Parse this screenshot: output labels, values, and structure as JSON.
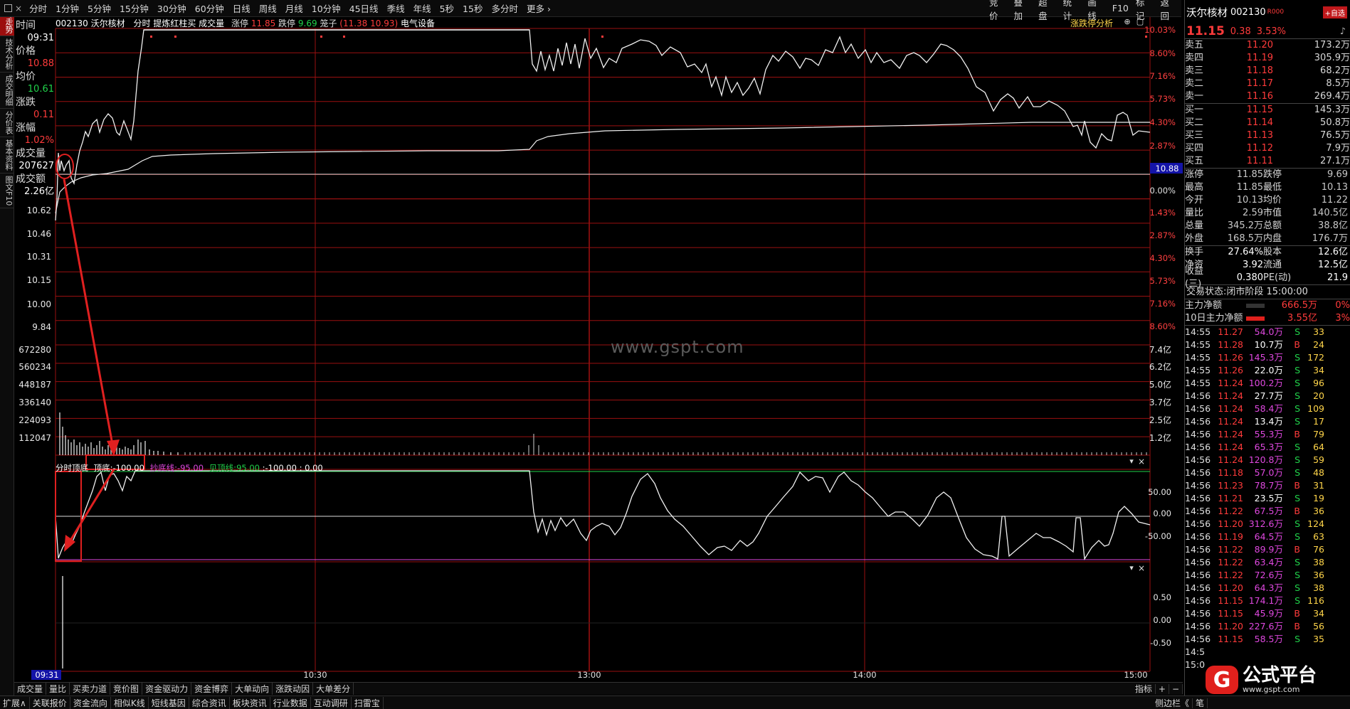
{
  "toolbar": {
    "items": [
      "分时",
      "1分钟",
      "5分钟",
      "15分钟",
      "30分钟",
      "60分钟",
      "日线",
      "周线",
      "月线",
      "10分钟",
      "45日线",
      "季线",
      "年线",
      "5秒",
      "15秒",
      "多分时",
      "更多 ›"
    ],
    "right": [
      "竞价",
      "叠加",
      "超盘",
      "统计",
      "画线",
      "F10",
      "标记",
      "返回"
    ]
  },
  "sidetabs": [
    "分时走势",
    "技术分析",
    "成交明细",
    "分价表",
    "基本资料",
    "图文F10"
  ],
  "info": {
    "labels": [
      "时间",
      "价格",
      "均价",
      "涨跌",
      "涨幅",
      "成交量",
      "成交额"
    ],
    "time": "09:31",
    "price": "10.88",
    "avg": "10.61",
    "change": "0.11",
    "pct": "1.02%",
    "volume": "207627",
    "amount": "2.26亿"
  },
  "header": {
    "code": "002130",
    "name": "沃尔核材",
    "mode": "分时",
    "hint": "提炼红柱买",
    "vol_label": "成交量",
    "lim_up_label": "涨停",
    "lim_up": "11.85",
    "lim_dn_label": "跌停",
    "lim_dn": "9.69",
    "box_label": "笼子",
    "box": "(11.38 10.93)",
    "sector": "电气设备",
    "analysis": "涨跌停分析"
  },
  "price_axis": {
    "left": [
      "10.62",
      "10.46",
      "10.31",
      "10.15",
      "10.00",
      "9.84"
    ],
    "right": [
      "10.03%",
      "8.60%",
      "7.16%",
      "5.73%",
      "4.30%",
      "2.87%",
      "0.00%",
      "1.43%",
      "2.87%",
      "4.30%",
      "5.73%",
      "7.16%",
      "8.60%"
    ],
    "current": "10.88"
  },
  "volume_axis": {
    "left": [
      "672280",
      "560234",
      "448187",
      "336140",
      "224093",
      "112047"
    ],
    "right": [
      "7.4亿",
      "6.2亿",
      "5.0亿",
      "3.7亿",
      "2.5亿",
      "1.2亿"
    ]
  },
  "indicator": {
    "name": "分时顶底",
    "top_label": "顶底:",
    "top_val": "-100.00",
    "buy_label": "抄底线:",
    "buy_val": "-95.00",
    "sell_label": "见顶线:",
    "sell_val": "95.00",
    "extra": ":-100.00 : 0.00",
    "axis": [
      "50.00",
      "0.00",
      "-50.00"
    ]
  },
  "indicator2": {
    "axis": [
      "0.50",
      "0.00",
      "-0.50"
    ]
  },
  "time_axis": {
    "start": "09:31",
    "labels": [
      "10:30",
      "13:00",
      "14:00",
      "15:00"
    ]
  },
  "watermark": "www.gspt.com",
  "rp": {
    "name": "沃尔核材",
    "code": "002130",
    "tag": "R000",
    "add": "+自选",
    "price": "11.15",
    "change": "0.38",
    "pct": "3.53%",
    "asks": [
      {
        "l": "卖五",
        "p": "11.20",
        "v": "173.2万"
      },
      {
        "l": "卖四",
        "p": "11.19",
        "v": "305.9万"
      },
      {
        "l": "卖三",
        "p": "11.18",
        "v": "68.2万"
      },
      {
        "l": "卖二",
        "p": "11.17",
        "v": "8.5万"
      },
      {
        "l": "卖一",
        "p": "11.16",
        "v": "269.4万"
      }
    ],
    "bids": [
      {
        "l": "买一",
        "p": "11.15",
        "v": "145.3万"
      },
      {
        "l": "买二",
        "p": "11.14",
        "v": "50.8万"
      },
      {
        "l": "买三",
        "p": "11.13",
        "v": "76.5万"
      },
      {
        "l": "买四",
        "p": "11.12",
        "v": "7.9万"
      },
      {
        "l": "买五",
        "p": "11.11",
        "v": "27.1万"
      }
    ],
    "stats": [
      [
        "涨停",
        "11.85",
        "跌停",
        "9.69"
      ],
      [
        "最高",
        "11.85",
        "最低",
        "10.13"
      ],
      [
        "今开",
        "10.13",
        "均价",
        "11.22"
      ],
      [
        "量比",
        "2.59",
        "市值",
        "140.5亿"
      ],
      [
        "总量",
        "345.2万",
        "总额",
        "38.8亿"
      ],
      [
        "外盘",
        "168.5万",
        "内盘",
        "176.7万"
      ]
    ],
    "stats2": [
      [
        "换手",
        "27.64%",
        "股本",
        "12.6亿"
      ],
      [
        "净资",
        "3.92",
        "流通",
        "12.5亿"
      ],
      [
        "收益(三)",
        "0.380",
        "PE(动)",
        "21.9"
      ]
    ],
    "status": "交易状态:闭市阶段 15:00:00",
    "flow": [
      {
        "l": "主力净额",
        "v": "666.5万",
        "p": "0%"
      },
      {
        "l": "10日主力净额",
        "v": "3.55亿",
        "p": "3%"
      }
    ],
    "ticks": [
      [
        "14:55",
        "11.27",
        "54.0万",
        "S",
        "33"
      ],
      [
        "14:55",
        "11.28",
        "10.7万",
        "B",
        "24"
      ],
      [
        "14:55",
        "11.26",
        "145.3万",
        "S",
        "172"
      ],
      [
        "14:55",
        "11.26",
        "22.0万",
        "S",
        "34"
      ],
      [
        "14:55",
        "11.24",
        "100.2万",
        "S",
        "96"
      ],
      [
        "14:56",
        "11.24",
        "27.7万",
        "S",
        "20"
      ],
      [
        "14:56",
        "11.24",
        "58.4万",
        "S",
        "109"
      ],
      [
        "14:56",
        "11.24",
        "13.4万",
        "S",
        "17"
      ],
      [
        "14:56",
        "11.24",
        "55.3万",
        "B",
        "79"
      ],
      [
        "14:56",
        "11.24",
        "65.3万",
        "S",
        "64"
      ],
      [
        "14:56",
        "11.24",
        "120.8万",
        "S",
        "59"
      ],
      [
        "14:56",
        "11.18",
        "57.0万",
        "S",
        "48"
      ],
      [
        "14:56",
        "11.23",
        "78.7万",
        "B",
        "31"
      ],
      [
        "14:56",
        "11.21",
        "23.5万",
        "S",
        "19"
      ],
      [
        "14:56",
        "11.22",
        "67.5万",
        "B",
        "36"
      ],
      [
        "14:56",
        "11.20",
        "312.6万",
        "S",
        "124"
      ],
      [
        "14:56",
        "11.19",
        "64.5万",
        "S",
        "63"
      ],
      [
        "14:56",
        "11.22",
        "89.9万",
        "B",
        "76"
      ],
      [
        "14:56",
        "11.22",
        "63.4万",
        "S",
        "38"
      ],
      [
        "14:56",
        "11.22",
        "72.6万",
        "S",
        "36"
      ],
      [
        "14:56",
        "11.20",
        "64.3万",
        "S",
        "38"
      ],
      [
        "14:56",
        "11.15",
        "174.1万",
        "S",
        "116"
      ],
      [
        "14:56",
        "11.15",
        "45.9万",
        "B",
        "34"
      ],
      [
        "14:56",
        "11.20",
        "227.6万",
        "B",
        "56"
      ],
      [
        "14:56",
        "11.15",
        "58.5万",
        "S",
        "35"
      ],
      [
        "14:5",
        ""
      ],
      [
        "15:0",
        ""
      ]
    ]
  },
  "bottombar": [
    "成交量",
    "量比",
    "买卖力道",
    "竞价图",
    "资金驱动力",
    "资金博弈",
    "大单动向",
    "涨跌动因",
    "大单差分"
  ],
  "bottombar_right": [
    "指标",
    "+",
    "−"
  ],
  "bottombar2": [
    "扩展∧",
    "关联报价",
    "资金流向",
    "相似K线",
    "短线基因",
    "综合资讯",
    "板块资讯",
    "行业数据",
    "互动调研",
    "扫雷宝"
  ],
  "bottombar2_right": [
    "侧边栏《",
    "笔"
  ],
  "logo": {
    "mark": "G",
    "title": "公式平台",
    "url": "www.gspt.com"
  }
}
